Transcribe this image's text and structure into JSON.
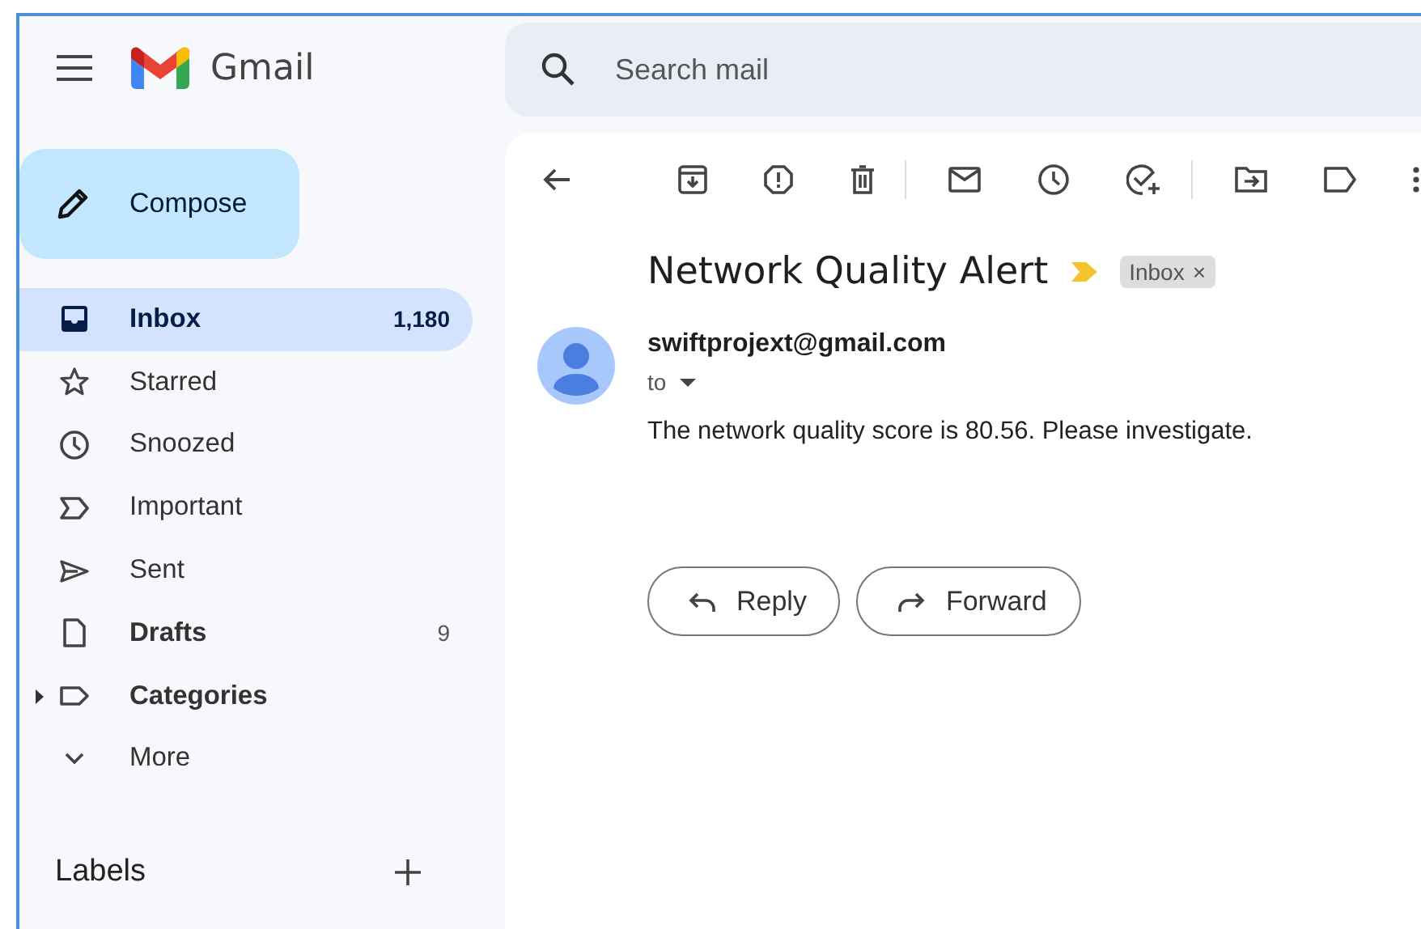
{
  "app": {
    "name": "Gmail"
  },
  "search": {
    "placeholder": "Search mail"
  },
  "compose": {
    "label": "Compose"
  },
  "sidebar": {
    "items": [
      {
        "kind": "inbox",
        "label": "Inbox",
        "count": "1,180",
        "selected": true,
        "unread": true,
        "collapsible": false
      },
      {
        "kind": "star",
        "label": "Starred",
        "selected": false,
        "unread": false,
        "collapsible": false
      },
      {
        "kind": "clock",
        "label": "Snoozed",
        "selected": false,
        "unread": false,
        "collapsible": false
      },
      {
        "kind": "important",
        "label": "Important",
        "selected": false,
        "unread": false,
        "collapsible": false
      },
      {
        "kind": "sent",
        "label": "Sent",
        "selected": false,
        "unread": false,
        "collapsible": false
      },
      {
        "kind": "draft",
        "label": "Drafts",
        "count": "9",
        "selected": false,
        "unread": true,
        "collapsible": false
      },
      {
        "kind": "label",
        "label": "Categories",
        "selected": false,
        "unread": true,
        "collapsible": true
      },
      {
        "kind": "more",
        "label": "More",
        "selected": false,
        "unread": false,
        "collapsible": false
      }
    ]
  },
  "labels": {
    "title": "Labels"
  },
  "email": {
    "subject": "Network Quality Alert",
    "important": true,
    "tags": [
      {
        "label": "Inbox",
        "close": "×"
      }
    ],
    "sender": "swiftprojext@gmail.com",
    "to": "to",
    "body": "The network quality score is 80.56. Please investigate.",
    "actions": [
      {
        "kind": "reply",
        "label": "Reply"
      },
      {
        "kind": "forward",
        "label": "Forward"
      }
    ]
  }
}
